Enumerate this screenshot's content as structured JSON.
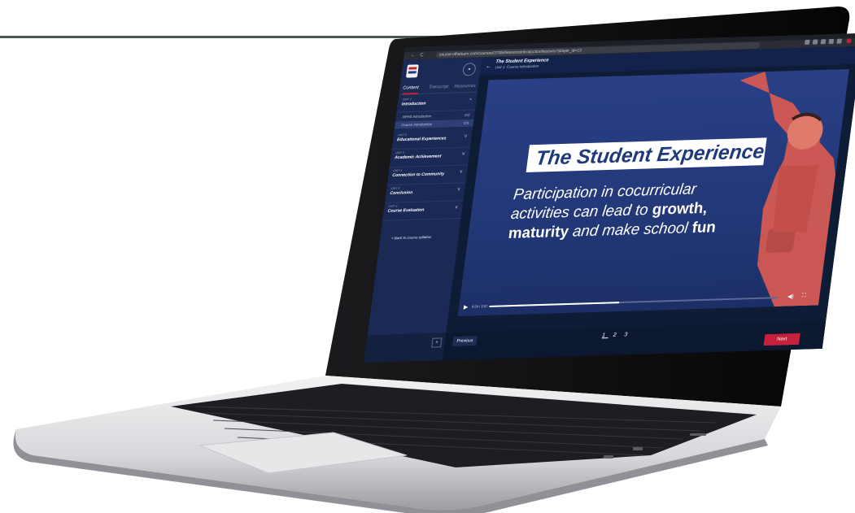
{
  "browser": {
    "url": "course.nfhslearn.com/courses/37084/lessons/introduction/lessons?player_id=13",
    "nav_back": "←",
    "nav_reload": "C"
  },
  "sidebar": {
    "tabs": [
      "Content",
      "Transcript",
      "Resources"
    ],
    "active_tab": "Content",
    "units": [
      {
        "num": "UNIT 1",
        "title": "Introduction",
        "chevron": "^"
      },
      {
        "num": "UNIT 2",
        "title": "Educational Experiences",
        "chevron": "v"
      },
      {
        "num": "UNIT 3",
        "title": "Academic Achievement",
        "chevron": "v"
      },
      {
        "num": "UNIT 4",
        "title": "Connection to Community",
        "chevron": "v"
      },
      {
        "num": "UNIT 5",
        "title": "Conclusion",
        "chevron": "v"
      },
      {
        "num": "UNIT 6",
        "title": "Course Evaluation",
        "chevron": "v"
      }
    ],
    "lessons": [
      {
        "label": "NFHS Introduction",
        "time": "0:0"
      },
      {
        "label": "Course Introduction",
        "time": "0:0"
      }
    ],
    "back_link": "< Back to course syllabus",
    "close_label": "×"
  },
  "header": {
    "title": "The Student Experience",
    "subtitle": "Unit 1: Course Introduction",
    "back_arrow": "←"
  },
  "video": {
    "title": "The Student Experience",
    "subtitle_parts": [
      "Participation in",
      "cocurricular activities",
      "can lead to",
      "growth,",
      "maturity",
      "and make school",
      "fun"
    ],
    "time": "0:24 / 2:57",
    "progress": 0.45
  },
  "footer": {
    "previous_label": "Previous",
    "pages": [
      "1",
      "2",
      "3"
    ],
    "next_label": "Next"
  },
  "colors": {
    "accent": "#c7203a",
    "sidebar": "#1a2a55",
    "video_bg": "#2a3f86",
    "title_text": "#1f3a7a"
  }
}
